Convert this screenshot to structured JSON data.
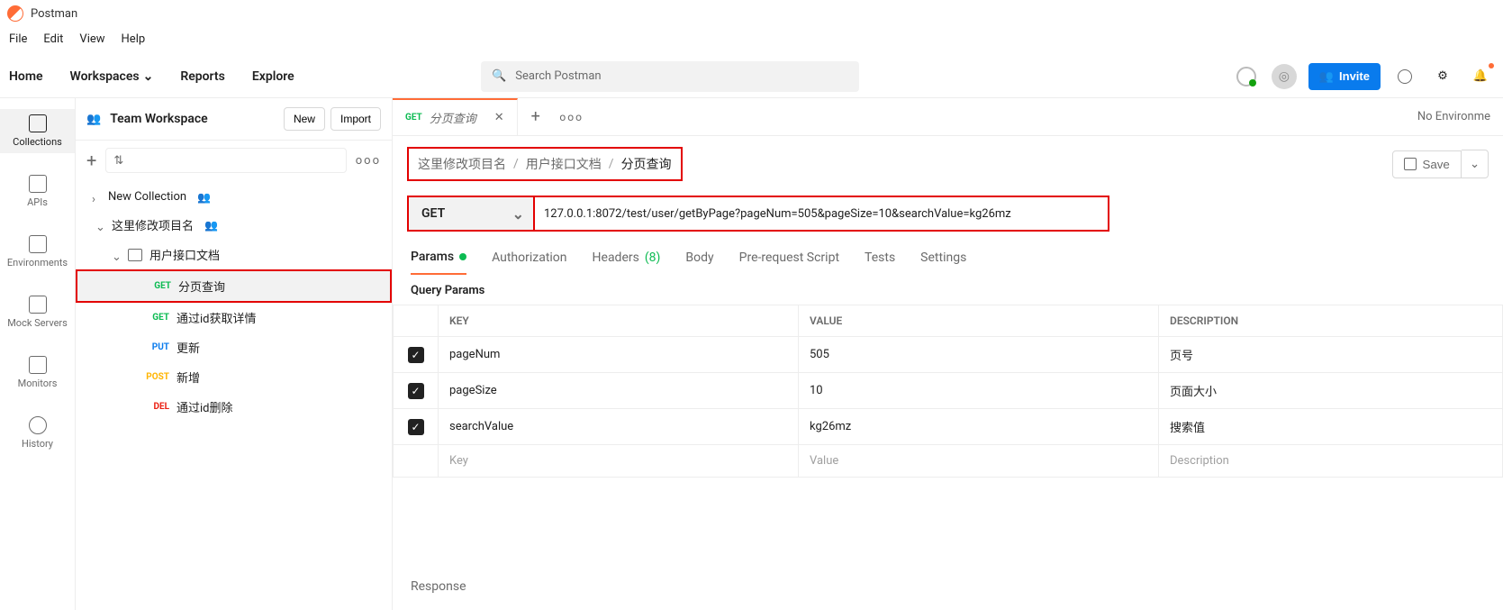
{
  "app": {
    "name": "Postman"
  },
  "menu": {
    "file": "File",
    "edit": "Edit",
    "view": "View",
    "help": "Help"
  },
  "topnav": {
    "home": "Home",
    "workspaces": "Workspaces",
    "reports": "Reports",
    "explore": "Explore",
    "search_placeholder": "Search Postman",
    "invite": "Invite"
  },
  "environment_label": "No Environme",
  "workspace": {
    "name": "Team Workspace",
    "new": "New",
    "import": "Import"
  },
  "rail": {
    "collections": "Collections",
    "apis": "APIs",
    "environments": "Environments",
    "mock": "Mock Servers",
    "monitors": "Monitors",
    "history": "History"
  },
  "tree": {
    "new_collection": "New Collection",
    "project": "这里修改项目名",
    "folder": "用户接口文档",
    "items": [
      {
        "method": "GET",
        "cls": "m-get",
        "name": "分页查询",
        "selected": true
      },
      {
        "method": "GET",
        "cls": "m-get",
        "name": "通过id获取详情"
      },
      {
        "method": "PUT",
        "cls": "m-put",
        "name": "更新"
      },
      {
        "method": "POST",
        "cls": "m-post",
        "name": "新增"
      },
      {
        "method": "DEL",
        "cls": "m-del",
        "name": "通过id删除"
      }
    ]
  },
  "tab": {
    "method": "GET",
    "title": "分页查询"
  },
  "breadcrumb": {
    "a": "这里修改项目名",
    "b": "用户接口文档",
    "c": "分页查询"
  },
  "save_label": "Save",
  "request": {
    "method": "GET",
    "url": "127.0.0.1:8072/test/user/getByPage?pageNum=505&pageSize=10&searchValue=kg26mz"
  },
  "req_tabs": {
    "params": "Params",
    "auth": "Authorization",
    "headers": "Headers",
    "headers_count": "(8)",
    "body": "Body",
    "prereq": "Pre-request Script",
    "tests": "Tests",
    "settings": "Settings"
  },
  "section": "Query Params",
  "table": {
    "headers": {
      "key": "KEY",
      "value": "VALUE",
      "desc": "DESCRIPTION"
    },
    "rows": [
      {
        "key": "pageNum",
        "value": "505",
        "desc": "页号"
      },
      {
        "key": "pageSize",
        "value": "10",
        "desc": "页面大小"
      },
      {
        "key": "searchValue",
        "value": "kg26mz",
        "desc": "搜索值"
      }
    ],
    "placeholders": {
      "key": "Key",
      "value": "Value",
      "desc": "Description"
    }
  },
  "response_label": "Response"
}
